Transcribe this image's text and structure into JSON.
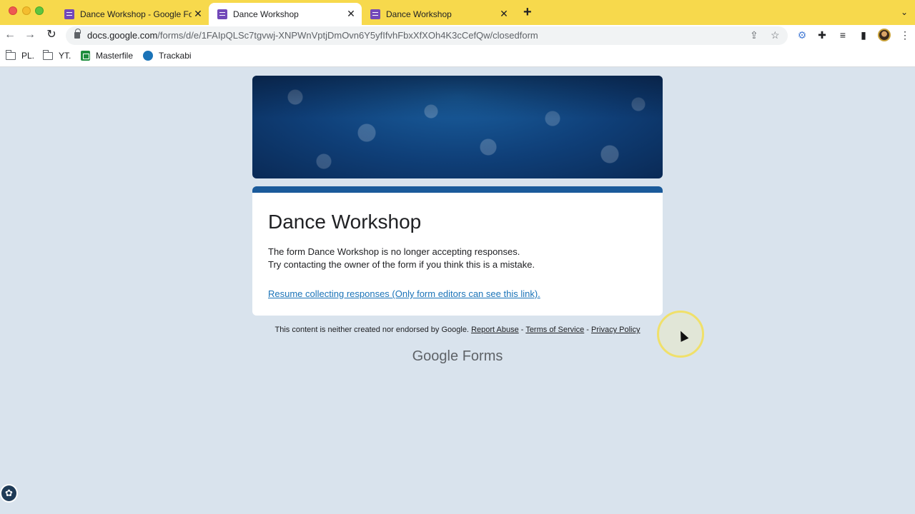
{
  "browser": {
    "tabs": [
      {
        "title": "Dance Workshop - Google Forms",
        "active": false
      },
      {
        "title": "Dance Workshop",
        "active": true
      },
      {
        "title": "Dance Workshop",
        "active": false
      }
    ],
    "tab_close_glyph": "✕",
    "new_tab_glyph": "+",
    "tab_menu_glyph": "⌄",
    "nav": {
      "back_glyph": "←",
      "forward_glyph": "→",
      "reload_glyph": "↻"
    },
    "url_host": "docs.google.com",
    "url_path": "/forms/d/e/1FAIpQLSc7tgvwj-XNPWnVptjDmOvn6Y5yfIfvhFbxXfXOh4K3cCefQw/closedform",
    "toolbar_icons": [
      "share-icon",
      "star-icon",
      "extension-icon",
      "puzzle-icon",
      "media-icon",
      "sidepanel-icon",
      "avatar",
      "menu-icon"
    ],
    "bookmarks": [
      {
        "label": "PL.",
        "icon": "folder-icon"
      },
      {
        "label": "YT.",
        "icon": "folder-icon"
      },
      {
        "label": "Masterfile",
        "icon": "sheets-icon"
      },
      {
        "label": "Trackabi",
        "icon": "trackabi-icon"
      }
    ]
  },
  "form": {
    "title": "Dance Workshop",
    "message_line1": "The form Dance Workshop is no longer accepting responses.",
    "message_line2": "Try contacting the owner of the form if you think this is a mistake.",
    "resume_link": "Resume collecting responses (Only form editors can see this link).",
    "accent_color": "#1a5a9a"
  },
  "footer": {
    "disclaimer": "This content is neither created nor endorsed by Google.",
    "report_abuse": "Report Abuse",
    "separator": "-",
    "terms": "Terms of Service",
    "privacy": "Privacy Policy",
    "brand_google": "Google",
    "brand_forms": "Forms"
  }
}
